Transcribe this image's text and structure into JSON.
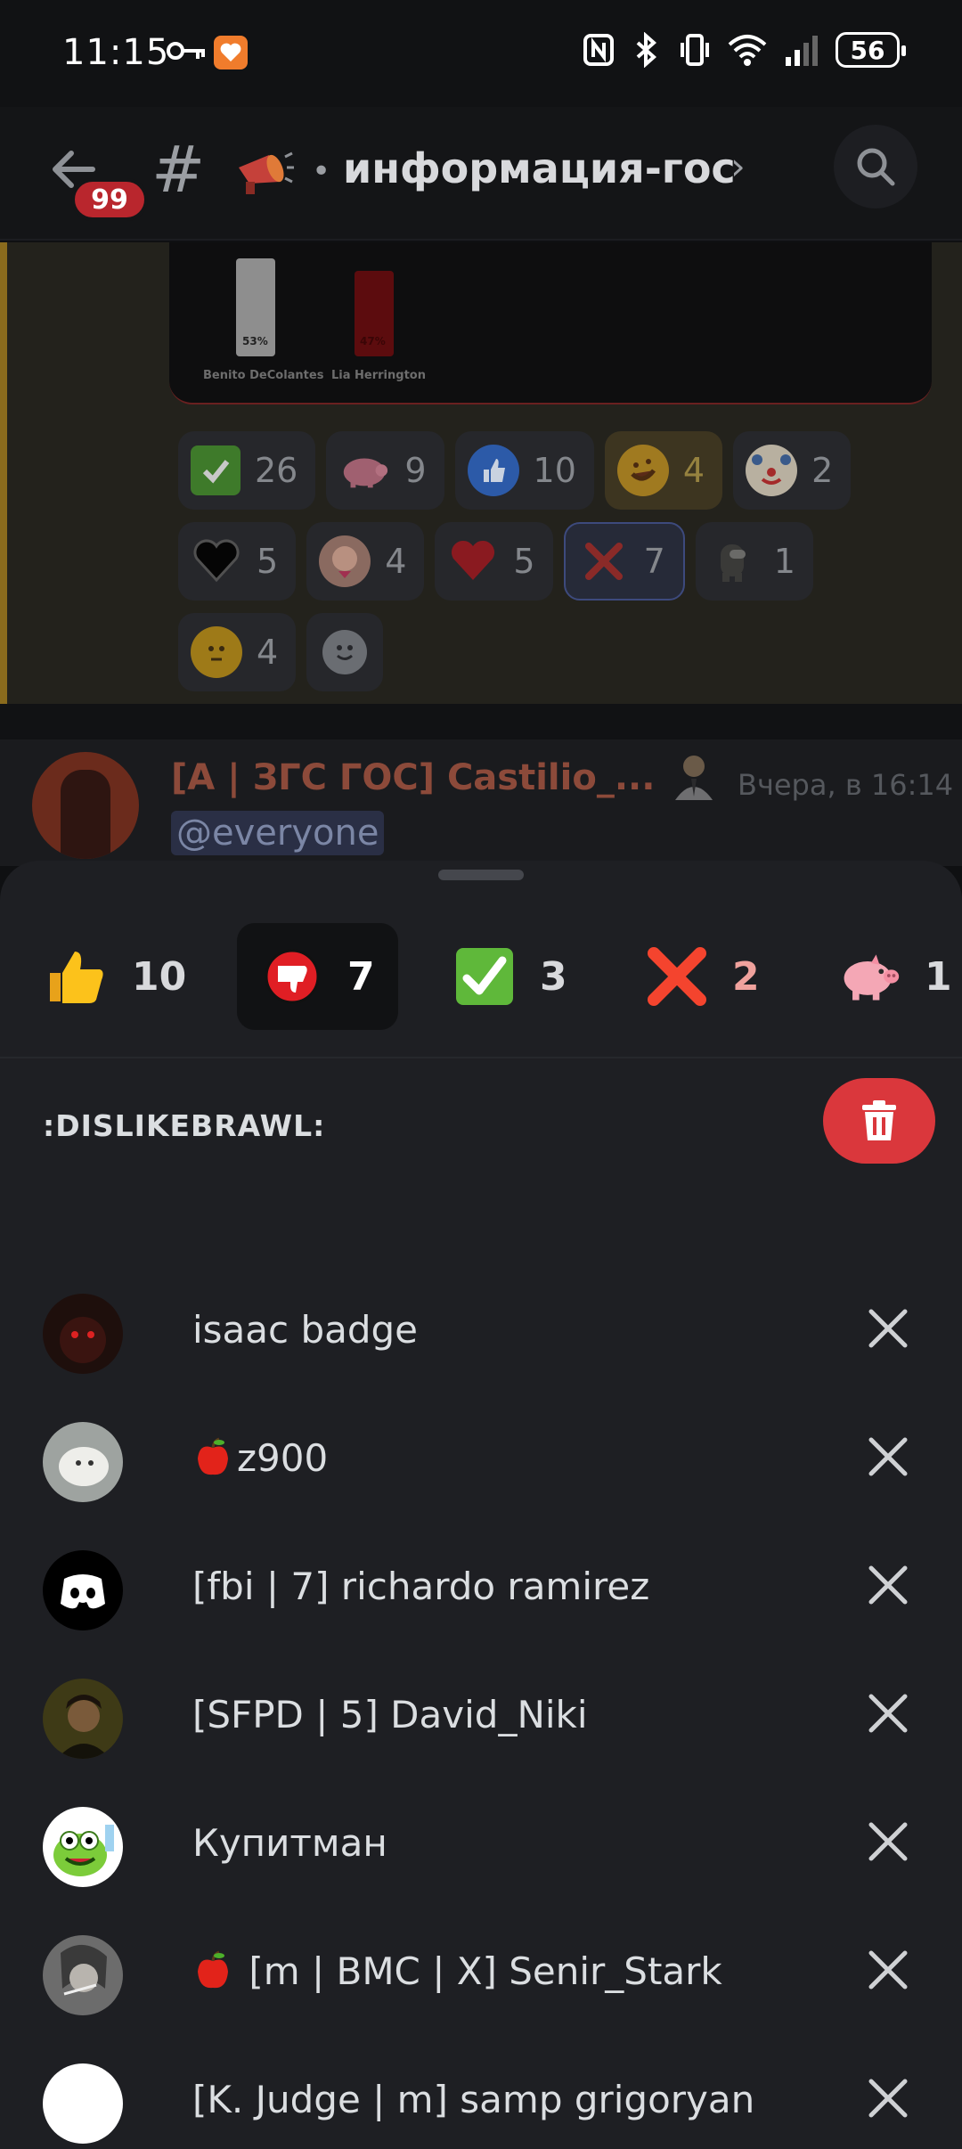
{
  "status_bar": {
    "time": "11:15",
    "battery": "56",
    "icons": [
      "key-icon",
      "health-app-icon",
      "nfc-icon",
      "bluetooth-icon",
      "vibrate-icon",
      "wifi-icon",
      "signal-icon",
      "battery-icon"
    ]
  },
  "header": {
    "back_badge": "99",
    "channel_name": "информация-гос",
    "hash_symbol": "#",
    "bullet": "•",
    "chevron": "›"
  },
  "chat": {
    "poll_chart": {
      "candidates": [
        {
          "name": "Benito DeColantes",
          "percent": "53%"
        },
        {
          "name": "Lia Herrington",
          "percent": "47%"
        }
      ]
    },
    "reaction_rows": [
      [
        {
          "emoji": "check-mark-icon",
          "count": "26"
        },
        {
          "emoji": "pig-icon",
          "count": "9"
        },
        {
          "emoji": "thumbs-up-blue-icon",
          "count": "10"
        },
        {
          "emoji": "rofl-icon",
          "count": "4",
          "highlight": true
        },
        {
          "emoji": "clown-icon",
          "count": "2"
        }
      ],
      [
        {
          "emoji": "black-heart-icon",
          "count": "5"
        },
        {
          "emoji": "anime-girl-icon",
          "count": "4"
        },
        {
          "emoji": "red-heart-icon",
          "count": "5"
        },
        {
          "emoji": "cross-mark-icon",
          "count": "7",
          "selected": true
        },
        {
          "emoji": "amogus-icon",
          "count": "1"
        }
      ],
      [
        {
          "emoji": "thinking-face-icon",
          "count": "4"
        },
        {
          "emoji": "add-reaction-icon",
          "count": ""
        }
      ]
    ],
    "next_message": {
      "author": "[А | ЗГС ГОС] Castilio_...",
      "timestamp": "Вчера, в 16:14",
      "mention": "@everyone"
    }
  },
  "sheet": {
    "tabs": [
      {
        "emoji": "thumbs-up-icon",
        "count": "10"
      },
      {
        "emoji": "dislikebrawl-icon",
        "count": "7",
        "active": true
      },
      {
        "emoji": "check-mark-icon",
        "count": "3"
      },
      {
        "emoji": "cross-mark-icon",
        "count": "2"
      },
      {
        "emoji": "pig-icon",
        "count": "1"
      }
    ],
    "emoji_name": ":DISLIKEBRAWL:",
    "users": [
      {
        "name": "isaac badge",
        "apple": false
      },
      {
        "name": "z900",
        "apple": true
      },
      {
        "name": "[fbi | 7] richardo ramirez",
        "apple": false
      },
      {
        "name": "[SFPD | 5] David_Niki",
        "apple": false
      },
      {
        "name": "Купитман",
        "apple": false
      },
      {
        "name": "[m | BMC | X] Senir_Stark",
        "apple": true
      },
      {
        "name": "[K. Judge | m] samp grigoryan",
        "apple": false
      }
    ]
  },
  "colors": {
    "accent_red": "#da373c",
    "sheet_bg": "#1e1f23",
    "text": "#dbdee1"
  }
}
